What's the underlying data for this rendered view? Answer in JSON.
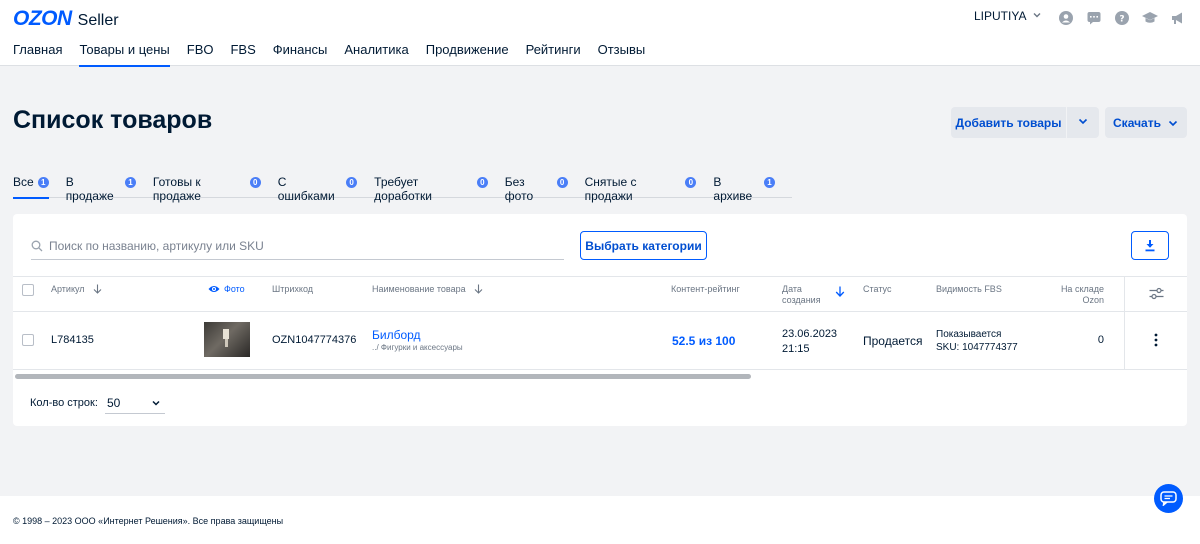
{
  "header": {
    "logo_brand": "OZON",
    "logo_product": "Seller",
    "user_name": "LIPUTIYA",
    "nav": [
      {
        "label": "Главная"
      },
      {
        "label": "Товары и цены"
      },
      {
        "label": "FBO"
      },
      {
        "label": "FBS"
      },
      {
        "label": "Финансы"
      },
      {
        "label": "Аналитика"
      },
      {
        "label": "Продвижение"
      },
      {
        "label": "Рейтинги"
      },
      {
        "label": "Отзывы"
      }
    ],
    "active_nav": "Товары и цены"
  },
  "page": {
    "title": "Список товаров",
    "add_button": "Добавить товары",
    "download_button": "Скачать"
  },
  "tabs": [
    {
      "label": "Все",
      "count": "1"
    },
    {
      "label": "В продаже",
      "count": "1"
    },
    {
      "label": "Готовы к продаже",
      "count": "0"
    },
    {
      "label": "С ошибками",
      "count": "0"
    },
    {
      "label": "Требует доработки",
      "count": "0"
    },
    {
      "label": "Без фото",
      "count": "0"
    },
    {
      "label": "Снятые с продажи",
      "count": "0"
    },
    {
      "label": "В архиве",
      "count": "1"
    }
  ],
  "filters": {
    "search_placeholder": "Поиск по названию, артикулу или SKU",
    "categories_button": "Выбрать категории"
  },
  "table": {
    "columns": {
      "article": "Артикул",
      "photo": "Фото",
      "barcode": "Штрихкод",
      "name": "Наименование товара",
      "content_rating": "Контент-рейтинг",
      "created_line1": "Дата",
      "created_line2": "создания",
      "status": "Статус",
      "fbs_visibility": "Видимость FBS",
      "stock_line1": "На складе",
      "stock_line2": "Ozon"
    },
    "rows": [
      {
        "article": "L784135",
        "barcode": "OZN1047774376",
        "name": "Билборд",
        "category": "../ Фигурки и аксессуары",
        "content_rating": "52.5 из 100",
        "created_date": "23.06.2023",
        "created_time": "21:15",
        "status": "Продается",
        "fbs_visibility": "Показывается",
        "sku": "SKU: 1047774377",
        "stock": "0"
      }
    ]
  },
  "pagination": {
    "rows_label": "Кол-во строк:",
    "rows_value": "50"
  },
  "footer": {
    "copyright": "© 1998 – 2023 ООО «Интернет Решения». Все права защищены"
  },
  "colors": {
    "brand": "#005bff",
    "text": "#001a34",
    "background": "#f2f3f5",
    "badge": "#4a7ef7"
  }
}
